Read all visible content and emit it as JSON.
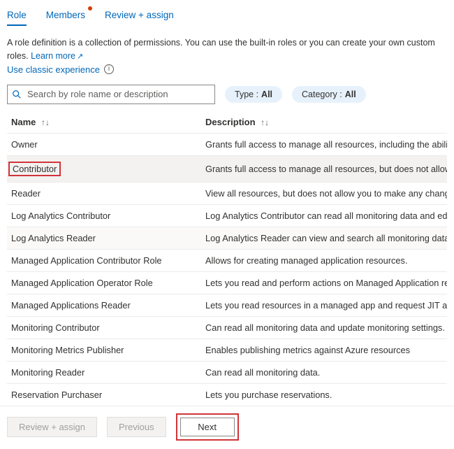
{
  "tabs": {
    "role": "Role",
    "members": "Members",
    "review": "Review + assign"
  },
  "intro": {
    "text": "A role definition is a collection of permissions. You can use the built-in roles or you can create your own custom roles.",
    "learnMore": "Learn more",
    "classic": "Use classic experience"
  },
  "search": {
    "placeholder": "Search by role name or description"
  },
  "filters": {
    "typeLabel": "Type :",
    "typeValue": "All",
    "categoryLabel": "Category :",
    "categoryValue": "All"
  },
  "columns": {
    "name": "Name",
    "description": "Description"
  },
  "rows": [
    {
      "name": "Owner",
      "desc": "Grants full access to manage all resources, including the ability to"
    },
    {
      "name": "Contributor",
      "desc": "Grants full access to manage all resources, but does not allow you"
    },
    {
      "name": "Reader",
      "desc": "View all resources, but does not allow you to make any changes."
    },
    {
      "name": "Log Analytics Contributor",
      "desc": "Log Analytics Contributor can read all monitoring data and edit m"
    },
    {
      "name": "Log Analytics Reader",
      "desc": "Log Analytics Reader can view and search all monitoring data as v"
    },
    {
      "name": "Managed Application Contributor Role",
      "desc": "Allows for creating managed application resources."
    },
    {
      "name": "Managed Application Operator Role",
      "desc": "Lets you read and perform actions on Managed Application resou"
    },
    {
      "name": "Managed Applications Reader",
      "desc": "Lets you read resources in a managed app and request JIT access"
    },
    {
      "name": "Monitoring Contributor",
      "desc": "Can read all monitoring data and update monitoring settings."
    },
    {
      "name": "Monitoring Metrics Publisher",
      "desc": "Enables publishing metrics against Azure resources"
    },
    {
      "name": "Monitoring Reader",
      "desc": "Can read all monitoring data."
    },
    {
      "name": "Reservation Purchaser",
      "desc": "Lets you purchase reservations."
    }
  ],
  "footer": {
    "reviewAssign": "Review + assign",
    "previous": "Previous",
    "next": "Next"
  }
}
